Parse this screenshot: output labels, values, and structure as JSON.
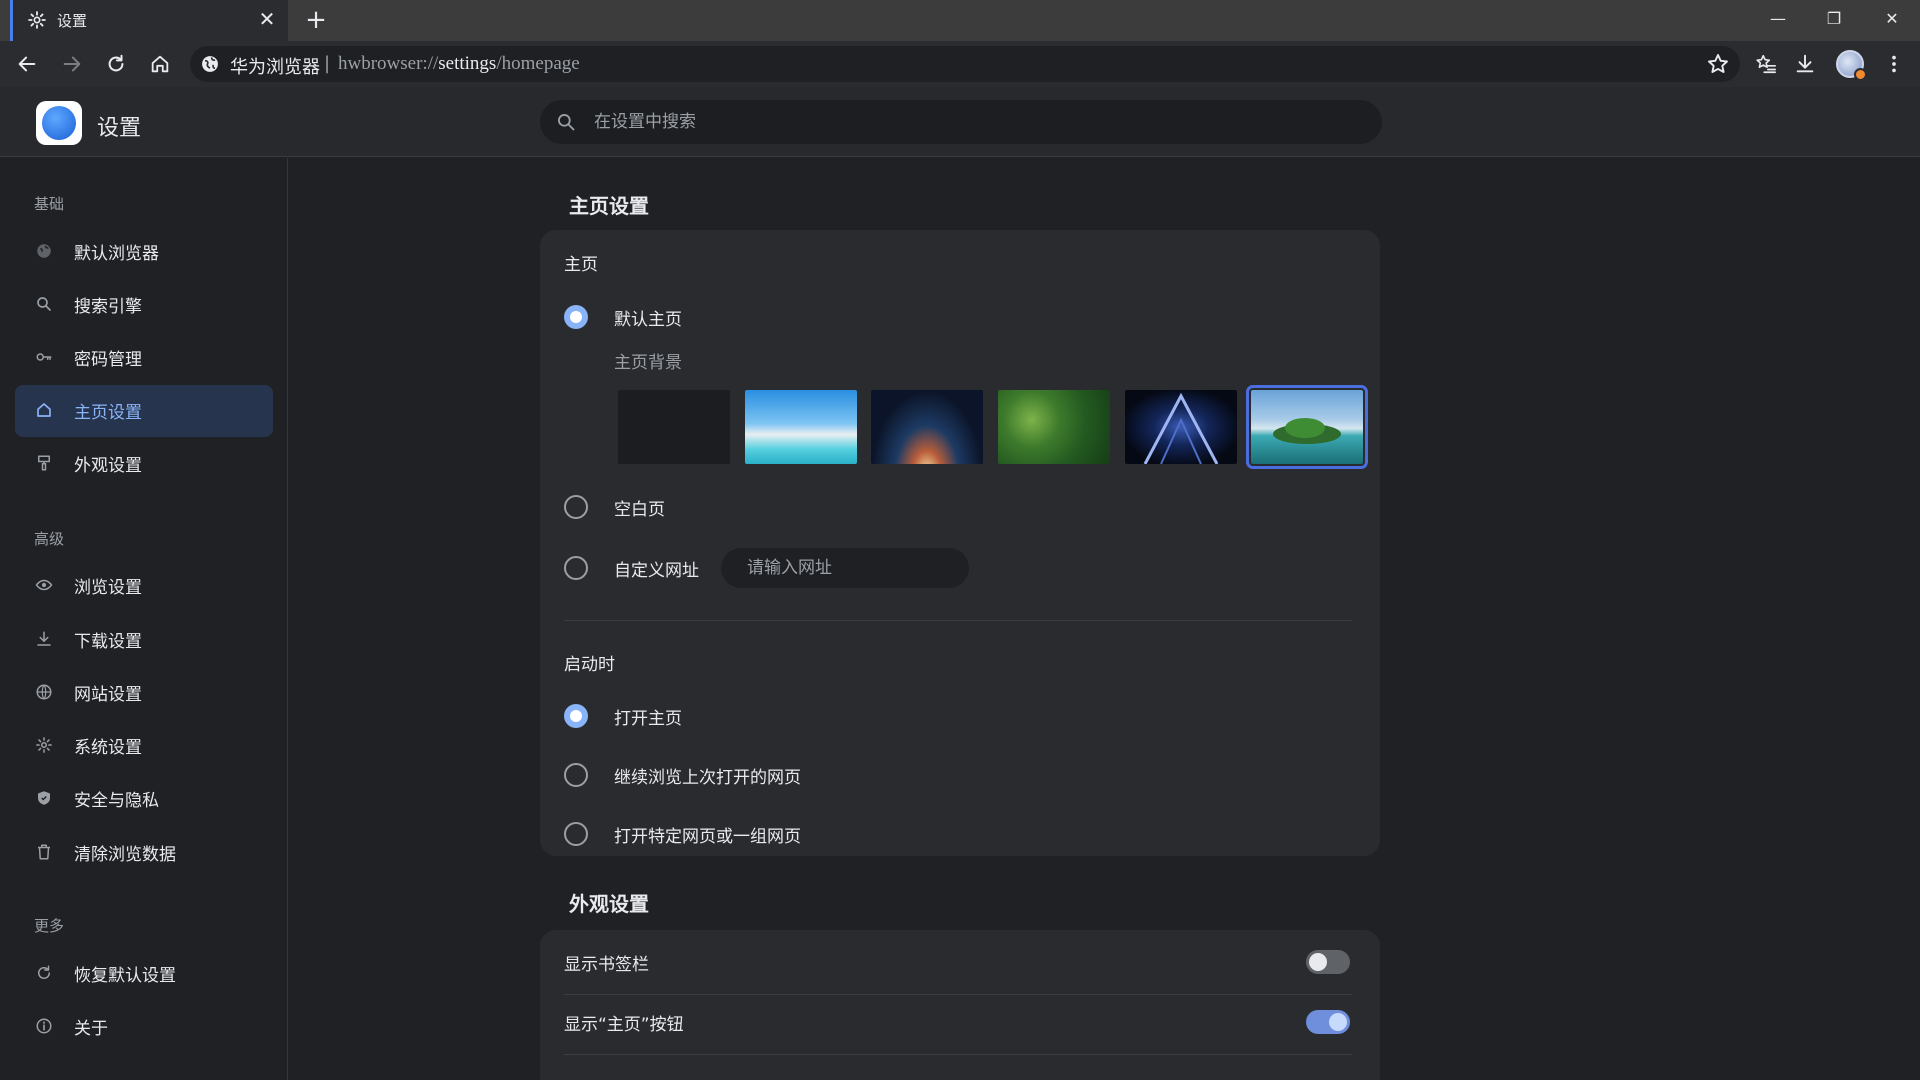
{
  "tab": {
    "title": "设置",
    "close": "✕",
    "new": "+"
  },
  "window": {
    "minimize": "—",
    "restore": "❐",
    "close": "✕"
  },
  "omnibox": {
    "brand": "华为浏览器",
    "separator": "|",
    "url_scheme": "hwbrowser://",
    "url_host": "settings",
    "url_path": "/homepage"
  },
  "header": {
    "title": "设置",
    "search_placeholder": "在设置中搜索"
  },
  "sidebar": {
    "sections": [
      {
        "title": "基础",
        "items": [
          {
            "label": "默认浏览器",
            "icon": "browser-icon"
          },
          {
            "label": "搜索引擎",
            "icon": "search-icon"
          },
          {
            "label": "密码管理",
            "icon": "key-icon"
          },
          {
            "label": "主页设置",
            "icon": "home-icon",
            "active": true
          },
          {
            "label": "外观设置",
            "icon": "paint-icon"
          }
        ]
      },
      {
        "title": "高级",
        "items": [
          {
            "label": "浏览设置",
            "icon": "eye-icon"
          },
          {
            "label": "下载设置",
            "icon": "download-icon"
          },
          {
            "label": "网站设置",
            "icon": "globe-icon"
          },
          {
            "label": "系统设置",
            "icon": "gear-icon"
          },
          {
            "label": "安全与隐私",
            "icon": "shield-icon"
          },
          {
            "label": "清除浏览数据",
            "icon": "trash-icon"
          }
        ]
      },
      {
        "title": "更多",
        "items": [
          {
            "label": "恢复默认设置",
            "icon": "reset-icon"
          },
          {
            "label": "关于",
            "icon": "info-icon"
          }
        ]
      }
    ]
  },
  "homepage": {
    "heading": "主页设置",
    "homepage_label": "主页",
    "options": [
      {
        "label": "默认主页",
        "checked": true
      },
      {
        "label": "空白页",
        "checked": false
      },
      {
        "label": "自定义网址",
        "checked": false
      }
    ],
    "background_label": "主页背景",
    "backgrounds_selected_index": 5,
    "custom_url_placeholder": "请输入网址",
    "startup_label": "启动时",
    "startup_options": [
      {
        "label": "打开主页",
        "checked": true
      },
      {
        "label": "继续浏览上次打开的网页",
        "checked": false
      },
      {
        "label": "打开特定网页或一组网页",
        "checked": false
      }
    ]
  },
  "appearance": {
    "heading": "外观设置",
    "toggles": [
      {
        "label": "显示书签栏",
        "on": false
      },
      {
        "label": "显示“主页”按钮",
        "on": true
      }
    ]
  },
  "colors": {
    "accent": "#8ab4f8",
    "active_bg": "#27344d",
    "card_bg": "#2a2b2e",
    "page_bg": "#202124"
  }
}
